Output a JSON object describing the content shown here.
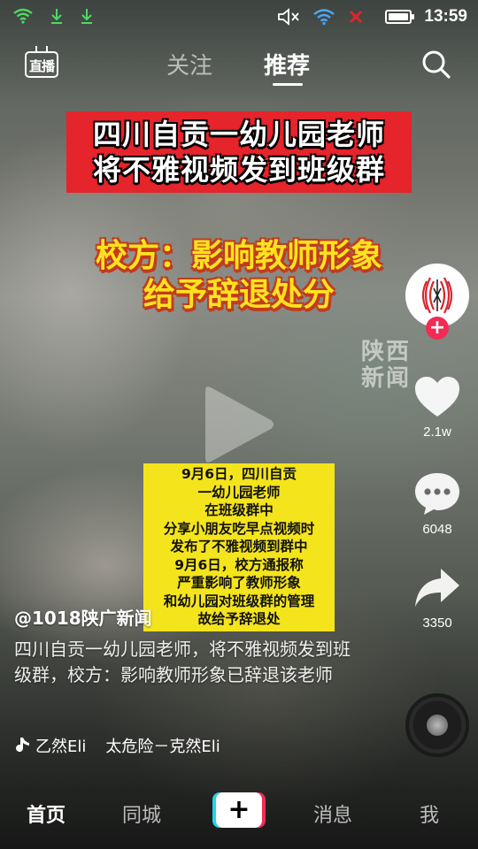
{
  "status_bar": {
    "time": "13:59",
    "icons": [
      "wifi-icon",
      "download-icon",
      "download-icon",
      "mute-icon",
      "wifi-icon",
      "no-signal-icon",
      "battery-icon"
    ],
    "battery_level": 0.85,
    "accent_download": "#4cd964",
    "accent_error": "#e0242d"
  },
  "top_nav": {
    "live_label": "直播",
    "tabs": [
      {
        "label": "关注",
        "active": false
      },
      {
        "label": "推荐",
        "active": true
      }
    ]
  },
  "video": {
    "banner_lines": [
      "四川自贡一幼儿园老师",
      "将不雅视频发到班级群"
    ],
    "subtitle_lines": [
      "校方：影响教师形象",
      "给予辞退处分"
    ],
    "watermark_lines": [
      "陕西",
      "新闻"
    ],
    "notice_lines": [
      "9月6日，四川自贡",
      "一幼儿园老师",
      "在班级群中",
      "分享小朋友吃早点视频时",
      "发布了不雅视频到群中",
      "9月6日，校方通报称",
      "严重影响了教师形象",
      "和幼儿园对班级群的管理",
      "故给予辞退处"
    ],
    "banner_color": "#e5242b",
    "subtitle_color": "#ffe21f",
    "notice_color": "#f4e41c"
  },
  "actions": {
    "likes": "2.1w",
    "comments": "6048",
    "shares": "3350",
    "follow_label": "+",
    "accent": "#f02c55"
  },
  "post": {
    "author": "@1018陕广新闻",
    "caption": "四川自贡一幼儿园老师，将不雅视频发到班级群，校方：影响教师形象已辞退该老师",
    "music_part1": "乙然Eli",
    "music_part2": "太危险－克然Eli"
  },
  "bottom_nav": {
    "home": "首页",
    "city": "同城",
    "create": "+",
    "messages": "消息",
    "me": "我"
  }
}
